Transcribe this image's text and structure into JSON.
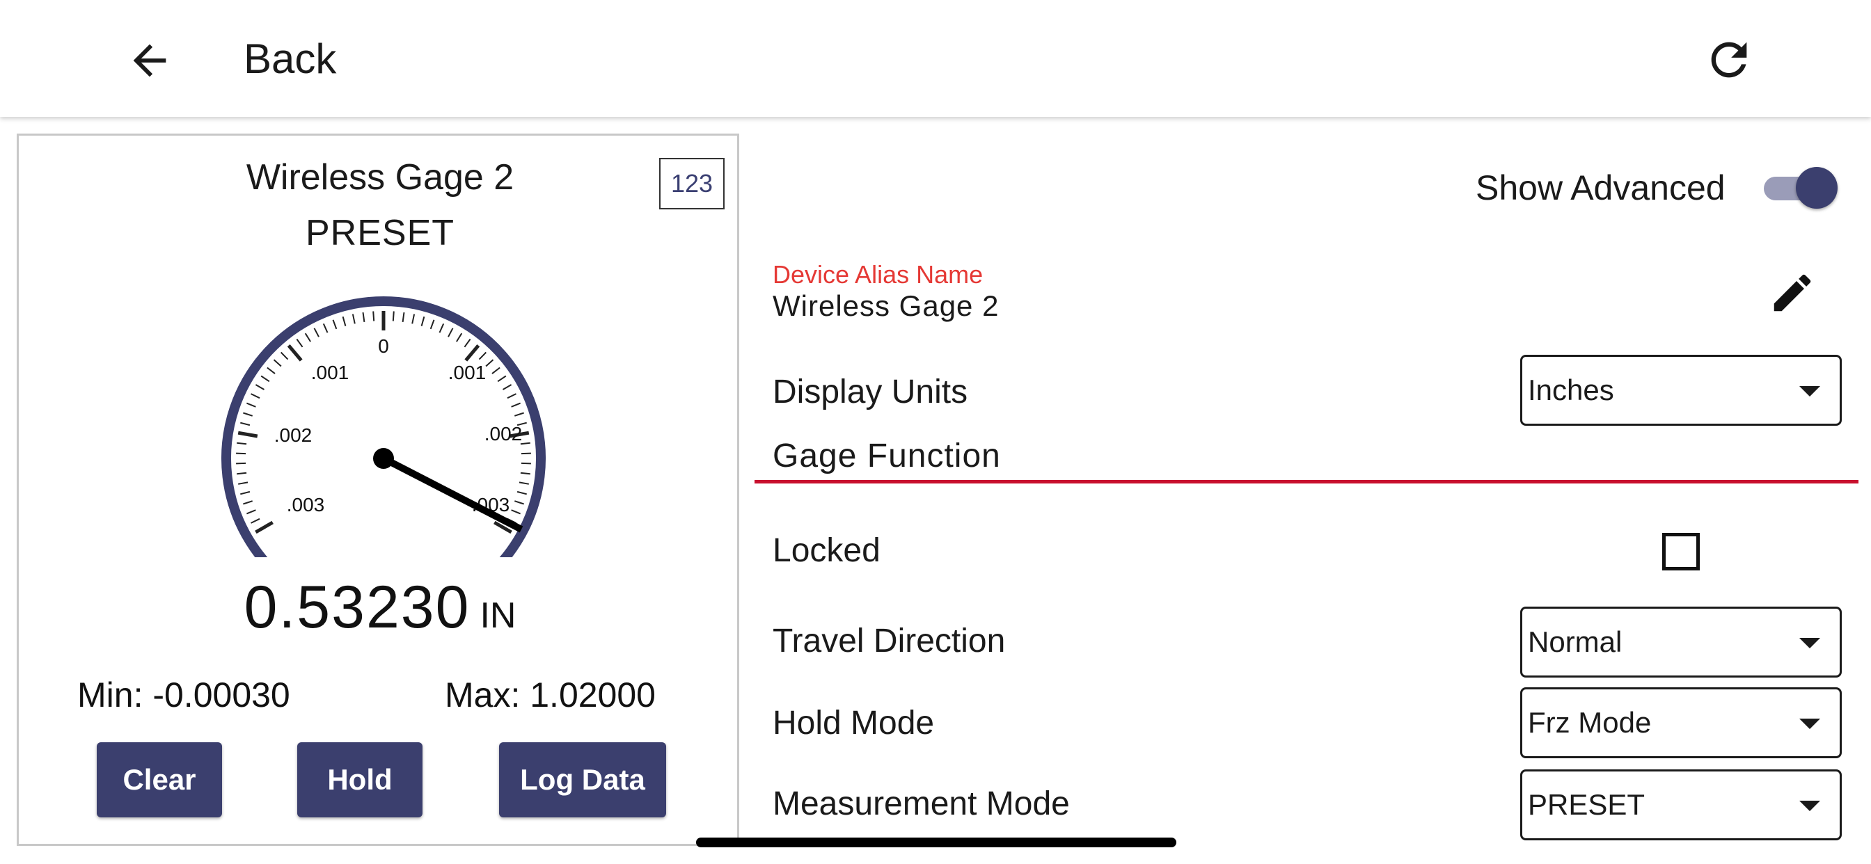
{
  "header": {
    "back_label": "Back",
    "back_icon": "arrow-left-icon",
    "refresh_icon": "refresh-icon"
  },
  "gage": {
    "title": "Wireless Gage 2",
    "mode": "PRESET",
    "numeric_button_label": "123",
    "dial": {
      "labels_left": [
        ".001",
        ".002",
        ".003"
      ],
      "labels_right": [
        ".001",
        ".002",
        ".003"
      ],
      "center_label": "0",
      "accent_color": "#3b3f6e"
    },
    "reading_value": "0.53230",
    "reading_unit": "IN",
    "min_text": "Min: -0.00030",
    "max_text": "Max: 1.02000",
    "buttons": {
      "clear": "Clear",
      "hold": "Hold",
      "log_data": "Log Data"
    }
  },
  "settings": {
    "show_advanced_label": "Show Advanced",
    "show_advanced_on": true,
    "alias_caption": "Device Alias Name",
    "alias_value": "Wireless Gage 2",
    "display_units_label": "Display Units",
    "display_units_value": "Inches",
    "section_title": "Gage Function",
    "locked_label": "Locked",
    "locked_checked": false,
    "travel_direction_label": "Travel Direction",
    "travel_direction_value": "Normal",
    "hold_mode_label": "Hold Mode",
    "hold_mode_value": "Frz Mode",
    "measurement_mode_label": "Measurement Mode",
    "measurement_mode_value": "PRESET"
  },
  "colors": {
    "primary": "#3b3f6e",
    "alias_caption": "#e53935",
    "section_rule": "#c8102e"
  }
}
